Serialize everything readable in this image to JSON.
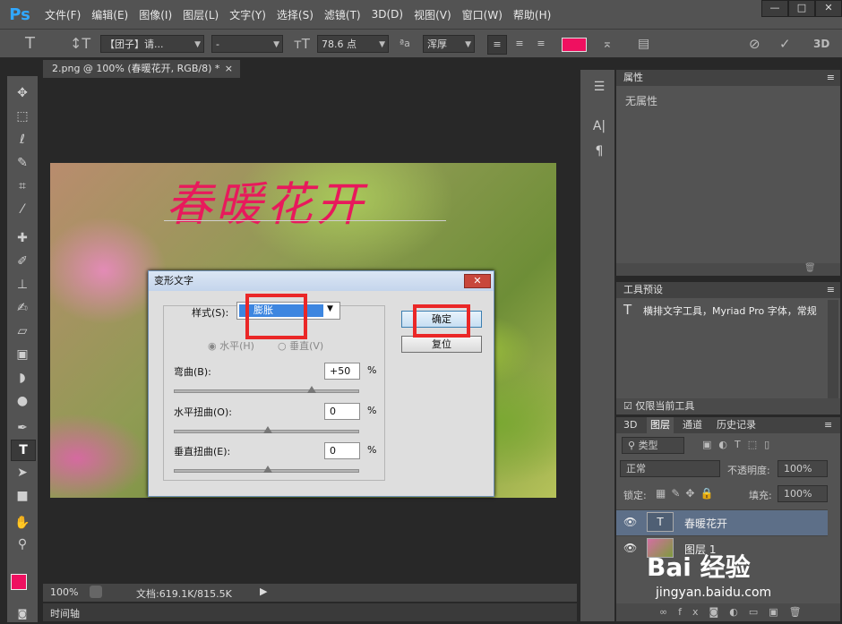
{
  "app": {
    "logo": "Ps"
  },
  "menu": [
    "文件(F)",
    "编辑(E)",
    "图像(I)",
    "图层(L)",
    "文字(Y)",
    "选择(S)",
    "滤镜(T)",
    "3D(D)",
    "视图(V)",
    "窗口(W)",
    "帮助(H)"
  ],
  "window_controls": {
    "minimize": "—",
    "maximize": "□",
    "close": "✕"
  },
  "options": {
    "font_family": "【团子】请...",
    "font_style": "-",
    "font_size": "78.6 点",
    "antialias": "浑厚",
    "text_color": "#ef1060"
  },
  "document": {
    "tab_title": "2.png @ 100% (春暖花开, RGB/8) *",
    "canvas_text": "春暖花开",
    "zoom": "100%",
    "doc_size": "文档:619.1K/815.5K",
    "timeline_label": "时间轴"
  },
  "properties": {
    "title": "属性",
    "empty_text": "无属性"
  },
  "presets": {
    "title": "工具预设",
    "item": "横排文字工具，Myriad Pro 字体，常规",
    "current_only": "仅限当前工具"
  },
  "layers": {
    "tabs": [
      "3D",
      "图层",
      "通道",
      "历史记录"
    ],
    "filter_type": "类型",
    "blend_mode": "正常",
    "opacity_label": "不透明度:",
    "opacity_value": "100%",
    "lock_label": "锁定:",
    "fill_label": "填充:",
    "fill_value": "100%",
    "items": [
      {
        "name": "春暖花开",
        "kind": "text"
      },
      {
        "name": "图层 1",
        "kind": "image"
      }
    ]
  },
  "warp_dialog": {
    "title": "变形文字",
    "style_label": "样式(S):",
    "style_value": "膨胀",
    "horizontal_label": "水平(H)",
    "vertical_label": "垂直(V)",
    "bend_label": "弯曲(B):",
    "bend_value": "+50",
    "hdist_label": "水平扭曲(O):",
    "hdist_value": "0",
    "vdist_label": "垂直扭曲(E):",
    "vdist_value": "0",
    "percent": "%",
    "ok_label": "确定",
    "reset_label": "复位",
    "bend_pct": 75,
    "hdist_pct": 50,
    "vdist_pct": 50
  },
  "watermark": {
    "brand": "Bai 经验",
    "url": "jingyan.baidu.com"
  }
}
